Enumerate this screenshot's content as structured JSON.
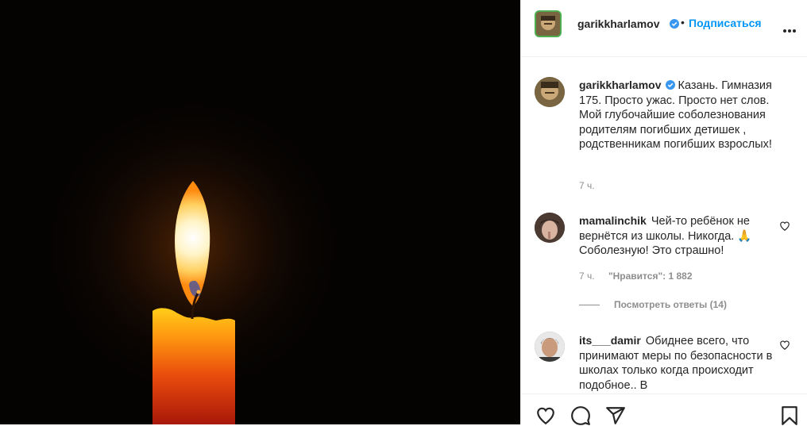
{
  "header": {
    "username": "garikkharlamov",
    "dot": "•",
    "follow_label": "Подписаться",
    "more_icon": "more-horizontal-icon"
  },
  "caption": {
    "username": "garikkharlamov",
    "text": "Казань. Гимназия 175. Просто ужас. Просто нет слов. Мой глубочайшие соболезнования родителям погибших детишек , родственникам погибших взрослых!",
    "time": "7 ч."
  },
  "comments": [
    {
      "username": "mamalinchik",
      "text": "Чей-то ребёнок не вернётся из школы. Никогда. 🙏 Соболезную! Это страшно!",
      "time": "7 ч.",
      "likes": "\"Нравится\": 1 882",
      "replies": "Посмотреть ответы (14)"
    },
    {
      "username": "its___damir",
      "text": "Обиднее всего, что принимают меры по безопасности в школах только когда происходит подобное.. В",
      "time": "",
      "likes": "",
      "replies": ""
    }
  ],
  "colors": {
    "accent": "#0095f6",
    "text": "#262626",
    "secondary": "#8e8e8e",
    "verified": "#3897f0"
  }
}
